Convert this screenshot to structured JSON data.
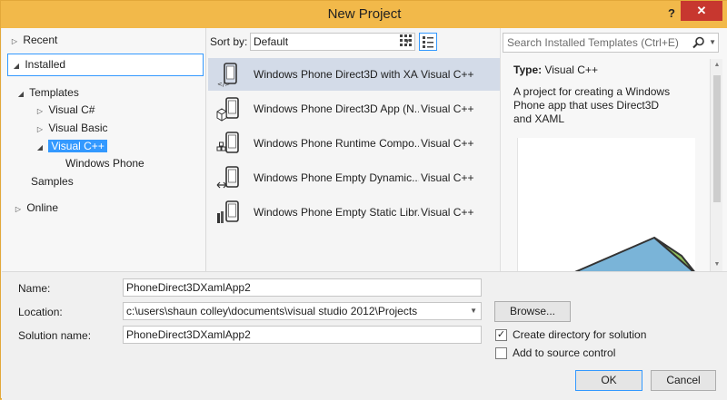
{
  "window": {
    "title": "New Project",
    "help": "?",
    "close": "✕"
  },
  "left_tree": {
    "recent": "Recent",
    "installed": "Installed",
    "templates": "Templates",
    "visual_csharp": "Visual C#",
    "visual_basic": "Visual Basic",
    "visual_cpp": "Visual C++",
    "windows_phone": "Windows Phone",
    "samples": "Samples",
    "online": "Online"
  },
  "toolbar": {
    "sort_by_label": "Sort by:",
    "sort_value": "Default"
  },
  "templates": [
    {
      "name": "Windows Phone Direct3D with XA...",
      "lang": "Visual C++",
      "selected": true,
      "icon": "phone-xaml-icon"
    },
    {
      "name": "Windows Phone Direct3D App (N...",
      "lang": "Visual C++",
      "selected": false,
      "icon": "phone-3d-cube-icon"
    },
    {
      "name": "Windows Phone Runtime Compo...",
      "lang": "Visual C++",
      "selected": false,
      "icon": "phone-component-icon"
    },
    {
      "name": "Windows Phone Empty Dynamic...",
      "lang": "Visual C++",
      "selected": false,
      "icon": "phone-dll-icon"
    },
    {
      "name": "Windows Phone Empty Static Libr...",
      "lang": "Visual C++",
      "selected": false,
      "icon": "phone-lib-icon"
    }
  ],
  "details": {
    "search_placeholder": "Search Installed Templates (Ctrl+E)",
    "type_label": "Type:",
    "type_value": "Visual C++",
    "description": "A project for creating a Windows Phone app that uses Direct3D and XAML"
  },
  "form": {
    "name_label": "Name:",
    "name_value": "PhoneDirect3DXamlApp2",
    "location_label": "Location:",
    "location_value": "c:\\users\\shaun colley\\documents\\visual studio 2012\\Projects",
    "solution_label": "Solution name:",
    "solution_value": "PhoneDirect3DXamlApp2",
    "browse": "Browse...",
    "create_dir": "Create directory for solution",
    "create_dir_checked": true,
    "add_source": "Add to source control",
    "add_source_checked": false,
    "ok": "OK",
    "cancel": "Cancel"
  },
  "colors": {
    "titlebar": "#f2b94a",
    "accent": "#3399ff",
    "close": "#c7372f",
    "selected_row": "#d3dbe8"
  }
}
